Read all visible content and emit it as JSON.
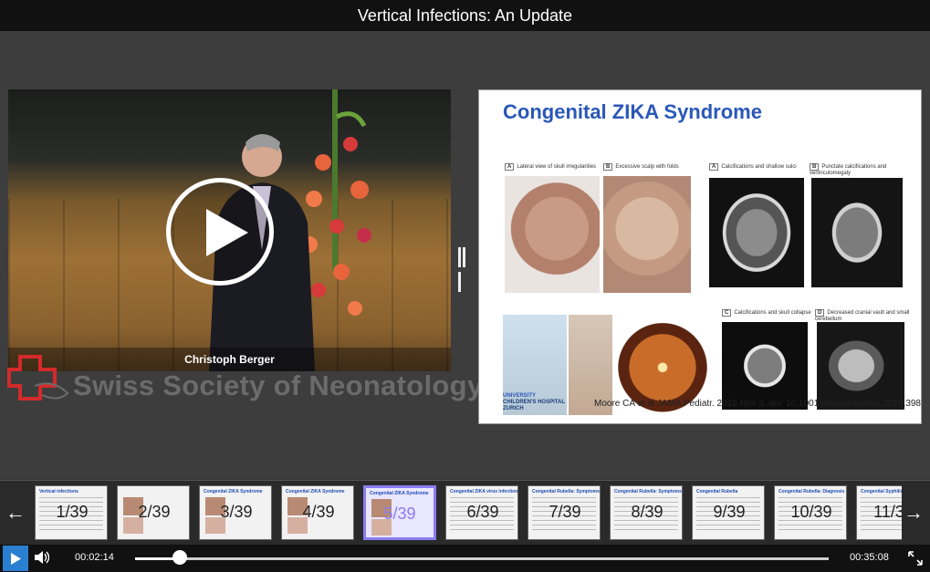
{
  "title": "Vertical Infections: An Update",
  "video": {
    "speaker_caption": "Christoph Berger",
    "play_icon": "play-icon"
  },
  "logo": {
    "name": "Swiss Society of Neonatology",
    "mark_color": "#d42a2a"
  },
  "slide": {
    "title": "Congenital ZIKA Syndrome",
    "panels": [
      {
        "letter": "A",
        "label": "Lateral view of skull irregularities"
      },
      {
        "letter": "B",
        "label": "Excessive scalp with folds"
      },
      {
        "letter": "A",
        "label": "Calcifications and shallow sulci"
      },
      {
        "letter": "B",
        "label": "Punctate calcifications and ventriculomegaly"
      },
      {
        "letter": "C",
        "label": "Calcifications and skull collapse"
      },
      {
        "letter": "D",
        "label": "Decreased cranial vault and small cerebellum"
      }
    ],
    "hospital": {
      "university": "UNIVERSITY",
      "name": "CHILDREN'S HOSPITAL",
      "city": "ZURICH"
    },
    "citation": "Moore CA et al JAMA Pediatr. 2016 Nov 3. doi: 10.1001/jamapediatrics.2016.3982"
  },
  "thumbnails": [
    {
      "label": "1/39",
      "title": "Vertical infections"
    },
    {
      "label": "2/39",
      "title": ""
    },
    {
      "label": "3/39",
      "title": "Congenital ZIKA Syndrome"
    },
    {
      "label": "4/39",
      "title": "Congenital ZIKA Syndrome"
    },
    {
      "label": "5/39",
      "title": "Congenital ZIKA Syndrome"
    },
    {
      "label": "6/39",
      "title": "Congenital ZIKA virus infection"
    },
    {
      "label": "7/39",
      "title": "Congenital Rubella: Symptoms"
    },
    {
      "label": "8/39",
      "title": "Congenital Rubella: Symptoms"
    },
    {
      "label": "9/39",
      "title": "Congenital Rubella"
    },
    {
      "label": "10/39",
      "title": "Congenital Rubella: Diagnosis and Prevention"
    },
    {
      "label": "11/39",
      "title": "Congenital Syphilis"
    }
  ],
  "active_thumbnail": 4,
  "player": {
    "current_time": "00:02:14",
    "duration": "00:35:08",
    "progress": 0.064,
    "accent_color": "#2b7fd1"
  }
}
